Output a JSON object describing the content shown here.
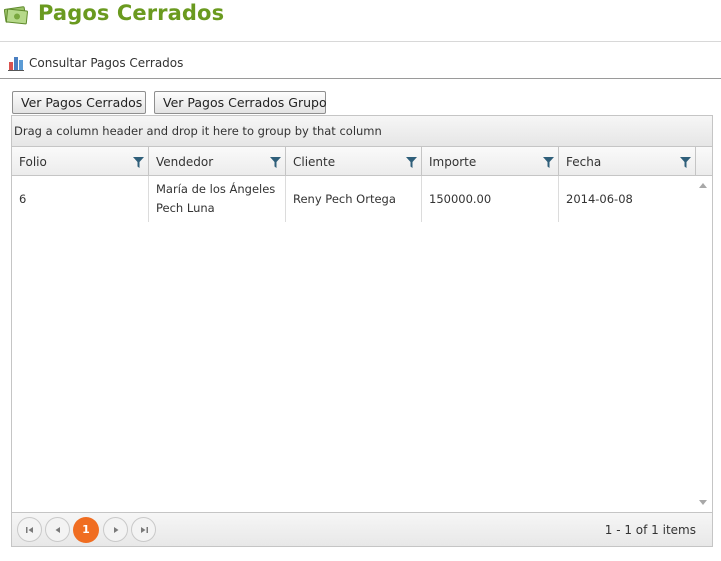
{
  "page": {
    "title": "Pagos Cerrados"
  },
  "action_bar": {
    "link_label": "Consultar Pagos Cerrados"
  },
  "buttons": {
    "ver_pagos": "Ver Pagos Cerrados",
    "ver_pagos_grupo": "Ver Pagos Cerrados Grupo"
  },
  "grid": {
    "group_hint": "Drag a column header and drop it here to group by that column",
    "columns": [
      "Folio",
      "Vendedor",
      "Cliente",
      "Importe",
      "Fecha"
    ],
    "rows": [
      {
        "folio": "6",
        "vendedor": "María de los Ángeles Pech Luna",
        "cliente": "Reny Pech Ortega",
        "importe": "150000.00",
        "fecha": "2014-06-08"
      }
    ]
  },
  "pager": {
    "current_page": "1",
    "info": "1 - 1 of 1 items"
  },
  "colors": {
    "title_green": "#6a9a1f",
    "pager_accent": "#f06d21",
    "filter_icon": "#2f5f7a"
  }
}
